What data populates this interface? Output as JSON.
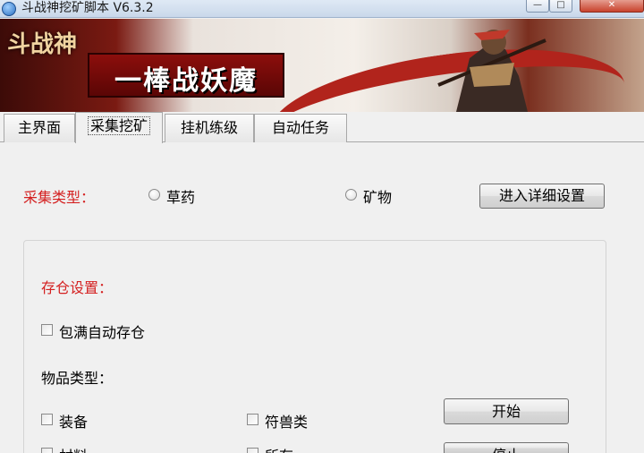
{
  "window": {
    "title": "斗战神挖矿脚本 V6.3.2",
    "ghost_text_1": "(behind title)",
    "ghost_text_2": "(behind title)",
    "minimize_glyph": "—",
    "maximize_glyph": "□",
    "close_glyph": "✕"
  },
  "banner": {
    "logo_text": "斗战神",
    "slogan": "一棒战妖魔"
  },
  "tabs": [
    {
      "label": "主界面"
    },
    {
      "label": "采集挖矿"
    },
    {
      "label": "挂机练级"
    },
    {
      "label": "自动任务"
    }
  ],
  "collect": {
    "type_label": "采集类型：",
    "option_herb": "草药",
    "option_ore": "矿物",
    "detail_button": "进入详细设置"
  },
  "storage": {
    "title": "存仓设置：",
    "auto_store": "包满自动存仓",
    "item_type_label": "物品类型：",
    "item_equipment": "装备",
    "item_beast": "符兽类",
    "item_material": "材料",
    "item_all": "所有"
  },
  "actions": {
    "start_button": "开始",
    "stop_button": "停止"
  },
  "colors": {
    "accent_red": "#d42020",
    "window_bg": "#f0f0f0"
  }
}
